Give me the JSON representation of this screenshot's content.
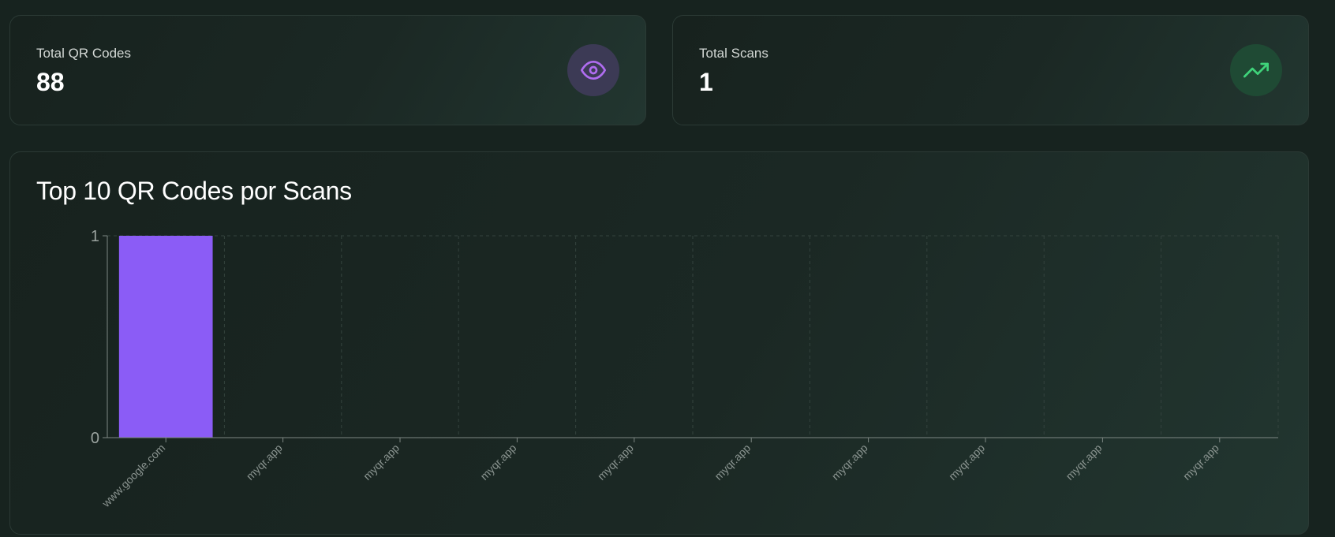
{
  "stats": {
    "qr": {
      "label": "Total QR Codes",
      "value": "88",
      "icon": "eye-icon",
      "icon_color": "#b06cf0"
    },
    "scans": {
      "label": "Total Scans",
      "value": "1",
      "icon": "trending-up-icon",
      "icon_color": "#3fd37a"
    }
  },
  "chart_data": {
    "type": "bar",
    "title": "Top 10 QR Codes por Scans",
    "categories": [
      "www.google.com",
      "myqr.app",
      "myqr.app",
      "myqr.app",
      "myqr.app",
      "myqr.app",
      "myqr.app",
      "myqr.app",
      "myqr.app",
      "myqr.app"
    ],
    "values": [
      1,
      0,
      0,
      0,
      0,
      0,
      0,
      0,
      0,
      0
    ],
    "ylim": [
      0,
      1
    ],
    "yticks": [
      0,
      1
    ],
    "xlabel": "",
    "ylabel": "",
    "grid": true,
    "bar_color": "#8b5cf6"
  }
}
